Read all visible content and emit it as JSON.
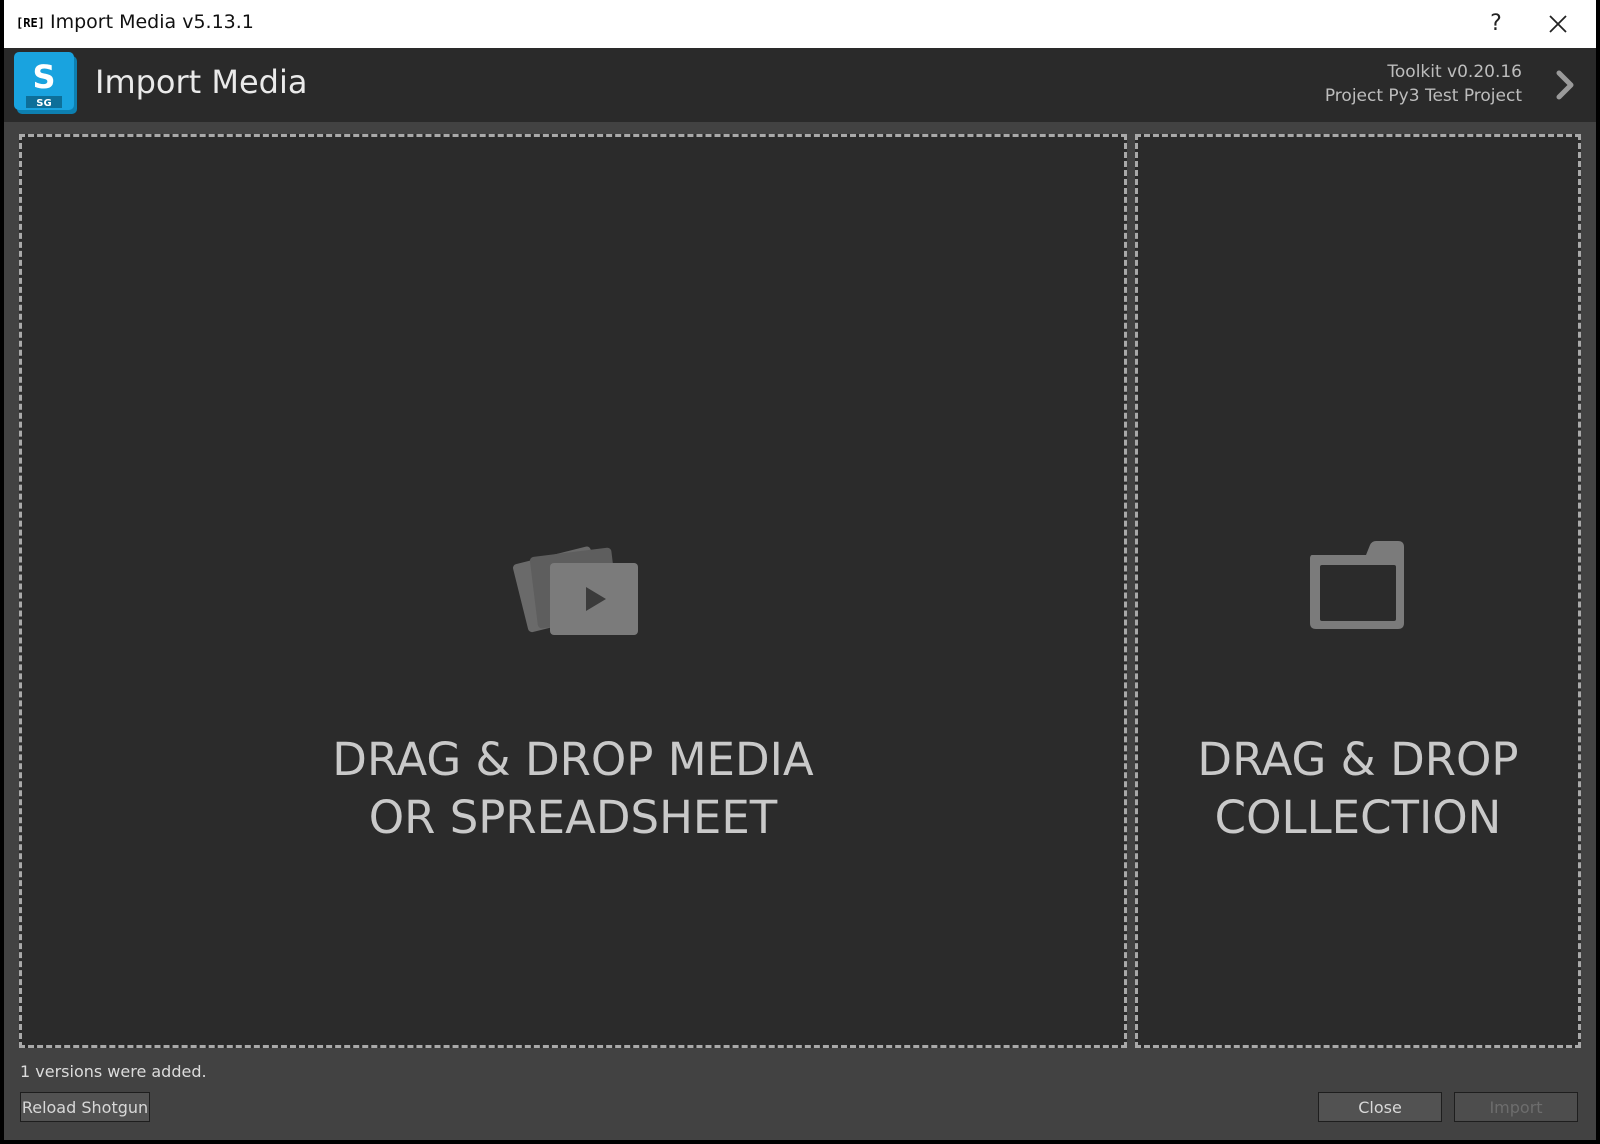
{
  "window": {
    "badge": "[RE]",
    "title": "Import Media v5.13.1",
    "help_label": "?"
  },
  "header": {
    "logo_letter": "S",
    "logo_sub": "SG",
    "app_title": "Import Media",
    "toolkit_version": "Toolkit v0.20.16",
    "project": "Project Py3 Test Project"
  },
  "drop_media": {
    "line1": "DRAG & DROP MEDIA",
    "line2": "OR SPREADSHEET",
    "icon": "media-stack-play-icon"
  },
  "drop_collection": {
    "line1": "DRAG & DROP",
    "line2": "COLLECTION",
    "icon": "folder-icon"
  },
  "status": "1 versions were added.",
  "buttons": {
    "reload": "Reload Shotgun",
    "close": "Close",
    "import": "Import"
  },
  "colors": {
    "logo_blue": "#0f9bd7",
    "background": "#2b2b2b",
    "panel": "#424242"
  }
}
